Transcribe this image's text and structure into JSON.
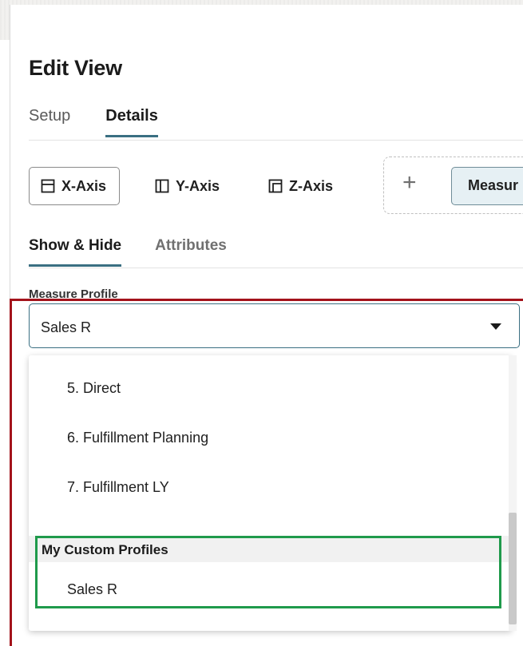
{
  "dialog": {
    "title": "Edit View"
  },
  "tabs": [
    {
      "label": "Setup",
      "active": false
    },
    {
      "label": "Details",
      "active": true
    }
  ],
  "axes": [
    {
      "label": "X-Axis",
      "icon": "x-axis-layout-icon",
      "selected": true
    },
    {
      "label": "Y-Axis",
      "icon": "y-axis-layout-icon",
      "selected": false
    },
    {
      "label": "Z-Axis",
      "icon": "z-axis-layout-icon",
      "selected": false
    }
  ],
  "add_icon": "plus-icon",
  "measure_chip": {
    "label": "Measur"
  },
  "subtabs": [
    {
      "label": "Show & Hide",
      "active": true
    },
    {
      "label": "Attributes",
      "active": false
    }
  ],
  "measure_profile": {
    "label": "Measure Profile",
    "value": "Sales R",
    "options": [
      "5. Direct",
      "6. Fulfillment Planning",
      "7. Fulfillment LY"
    ],
    "custom_group": {
      "header": "My Custom Profiles",
      "options": [
        "Sales R"
      ]
    }
  },
  "colors": {
    "accent": "#3a6f82",
    "highlight_red": "#a3131b",
    "highlight_green": "#1f9a4b",
    "chip_bg": "#e6f0f4"
  }
}
